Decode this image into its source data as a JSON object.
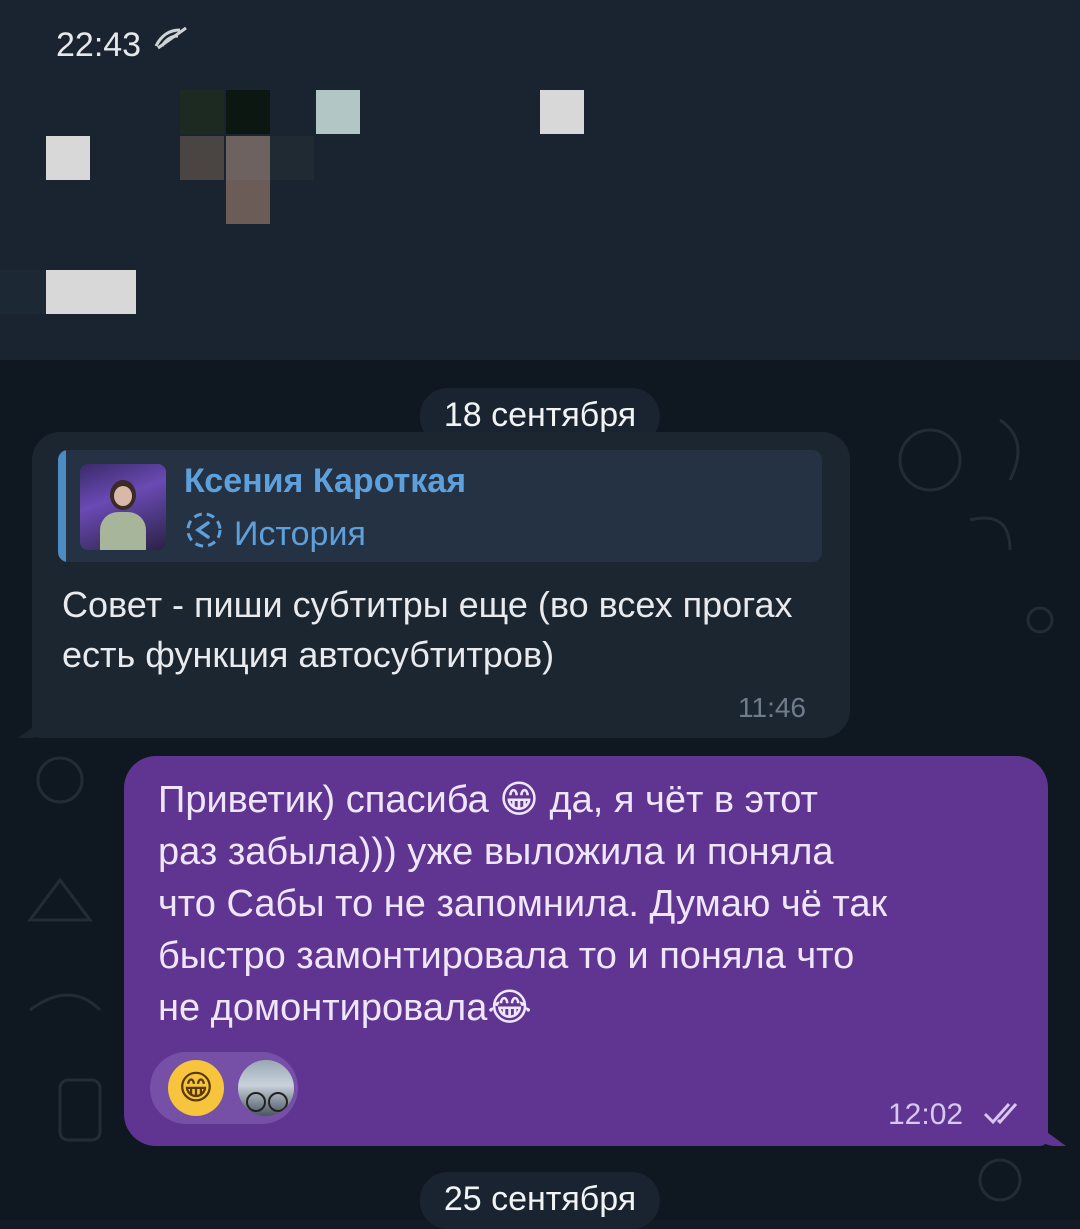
{
  "status_bar": {
    "time": "22:43",
    "network_icon": "signal-wifi-icon"
  },
  "chat": {
    "dates": [
      "18 сентября",
      "25 сентября"
    ],
    "incoming": {
      "reply": {
        "sender": "Ксения Кароткая",
        "label": "История",
        "icon": "story-reply-icon"
      },
      "text": "Совет - пиши субтитры еще (во всех прогах есть функция автосубтитров)",
      "time": "11:46"
    },
    "outgoing": {
      "text_lines": [
        "Приветик) спасиба 😁 да, я чёт в этот",
        "раз забыла))) уже выложила и поняла",
        "что Сабы то не запомнила. Думаю чё так",
        "быстро замонтировала то и поняла что",
        "не домонтировала😂"
      ],
      "reactions": [
        {
          "type": "emoji",
          "value": "😁"
        },
        {
          "type": "avatar",
          "value": "user-avatar"
        }
      ],
      "time": "12:02",
      "status_icon": "double-check-icon"
    }
  },
  "colors": {
    "outgoing_bubble": "#5f3591",
    "incoming_bubble": "#1c2631",
    "link_accent": "#5ea0dc"
  }
}
